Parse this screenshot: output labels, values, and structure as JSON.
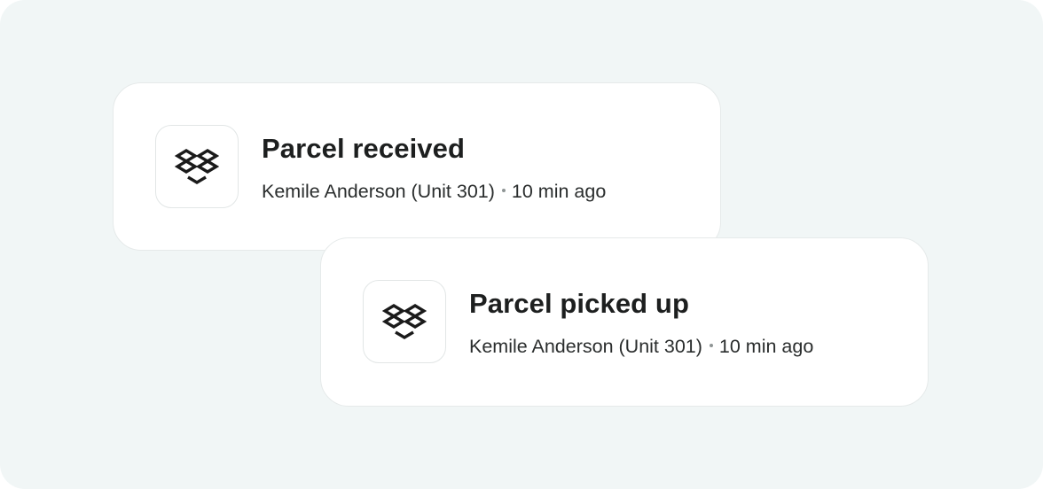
{
  "notifications": [
    {
      "icon": "parcel-box-icon",
      "title": "Parcel received",
      "resident": "Kemile Anderson (Unit 301)",
      "time": "10 min ago"
    },
    {
      "icon": "parcel-box-icon",
      "title": "Parcel picked up",
      "resident": "Kemile Anderson (Unit 301)",
      "time": "10 min ago"
    }
  ],
  "colors": {
    "background": "#f1f6f6",
    "card": "#ffffff",
    "text": "#1d1f1f"
  }
}
